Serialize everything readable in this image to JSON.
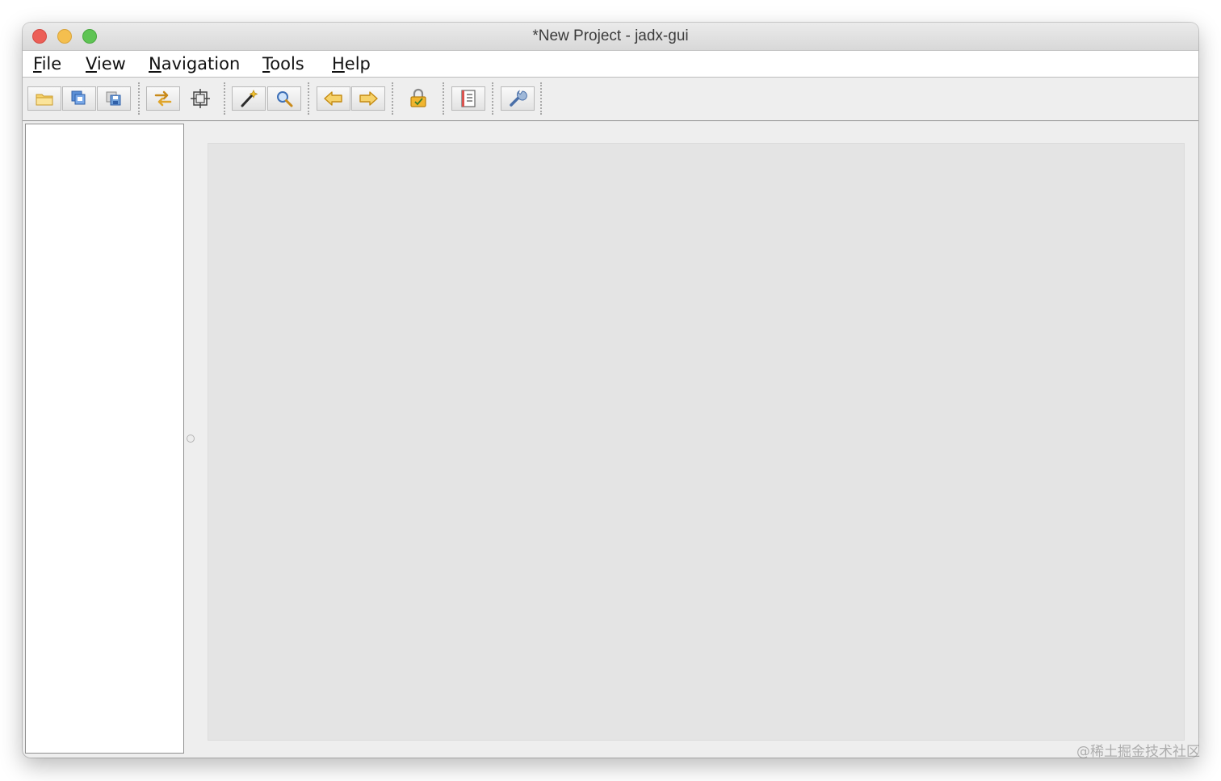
{
  "window": {
    "title": "*New Project - jadx-gui"
  },
  "menu": [
    {
      "label_first": "F",
      "label_rest": "ile"
    },
    {
      "label_first": "V",
      "label_rest": "iew"
    },
    {
      "label_first": "N",
      "label_rest": "avigation"
    },
    {
      "label_first": "T",
      "label_rest": "ools"
    },
    {
      "label_first": "H",
      "label_rest": "elp"
    }
  ],
  "toolbar": {
    "icons": [
      "open-folder-icon",
      "add-files-icon",
      "save-all-icon",
      "sync-icon",
      "flatten-packages-icon",
      "decompile-wand-icon",
      "search-icon",
      "back-arrow-icon",
      "forward-arrow-icon",
      "deobfuscation-lock-icon",
      "log-viewer-icon",
      "preferences-wrench-icon"
    ]
  },
  "colors": {
    "close": "#ec5f57",
    "minimize": "#f4bf4f",
    "maximize": "#5fc454",
    "content_background": "#e4e4e4"
  },
  "watermark": "@稀土掘金技术社区"
}
